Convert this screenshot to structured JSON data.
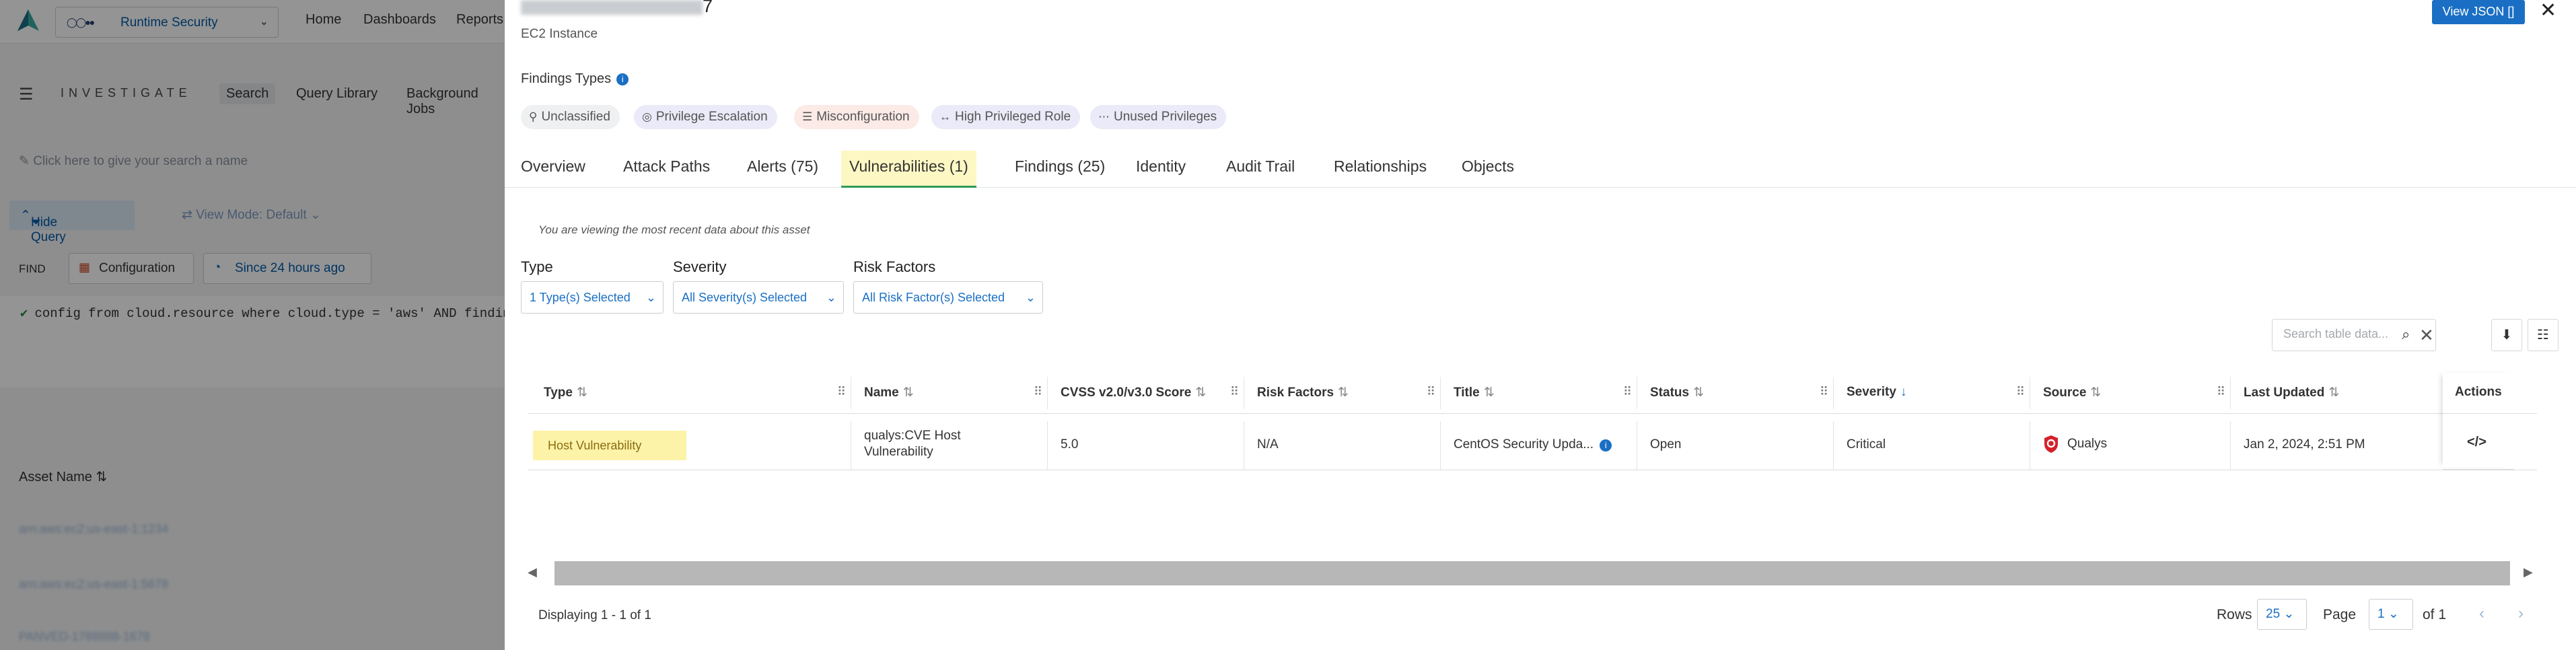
{
  "app": {
    "tenant_name": "Runtime Security",
    "nav": [
      "Home",
      "Dashboards",
      "Reports"
    ],
    "investigate_title": "INVESTIGATE",
    "investigate_tabs": [
      "Search",
      "Query Library",
      "Background Jobs"
    ],
    "search_name_placeholder": "Click here to give your search a name",
    "hide_query_label": "Hide Query",
    "view_mode_label": "View Mode: Default",
    "find_label": "FIND",
    "config_button": "Configuration",
    "time_button": "Since 24 hours ago",
    "query_text": "config from cloud.resource where cloud.type = 'aws' AND findin",
    "asset_name_header": "Asset Name",
    "asset_rows": [
      "arn:aws:ec2:us-east-1:1234",
      "arn:aws:ec2:us-east-1:5678",
      "PANVED-1788888-1678"
    ]
  },
  "panel": {
    "title_suffix": "7",
    "subtitle": "EC2 Instance",
    "view_json_label": "View JSON []",
    "close_icon": "close-icon",
    "findings_types_label": "Findings Types",
    "finding_chips": [
      {
        "label": "Unclassified",
        "icon": "search-icon",
        "glyph": "⚲",
        "bg": "#eef0f2",
        "fg": "#555555"
      },
      {
        "label": "Privilege Escalation",
        "icon": "privilege-escalation-icon",
        "glyph": "◎",
        "bg": "#eaeaf8",
        "fg": "#555555"
      },
      {
        "label": "Misconfiguration",
        "icon": "misconfiguration-icon",
        "glyph": "☰",
        "bg": "#fbeae6",
        "fg": "#555555"
      },
      {
        "label": "High Privileged Role",
        "icon": "high-privileged-role-icon",
        "glyph": "↔",
        "bg": "#eaeaf8",
        "fg": "#555555"
      },
      {
        "label": "Unused Privileges",
        "icon": "unused-privileges-icon",
        "glyph": "⋯",
        "bg": "#eaeaf8",
        "fg": "#555555"
      }
    ],
    "tabs": [
      "Overview",
      "Attack Paths",
      "Alerts (75)",
      "Vulnerabilities (1)",
      "Findings (25)",
      "Identity",
      "Audit Trail",
      "Relationships",
      "Objects"
    ],
    "active_tab": "Vulnerabilities (1)",
    "notice": "You are viewing the most recent data about this asset",
    "filters": {
      "type_label": "Type",
      "type_value": "1 Type(s) Selected",
      "severity_label": "Severity",
      "severity_value": "All Severity(s) Selected",
      "risk_label": "Risk Factors",
      "risk_value": "All Risk Factor(s) Selected"
    },
    "table_search_placeholder": "Search table data...",
    "columns": [
      "Type",
      "Name",
      "CVSS v2.0/v3.0 Score",
      "Risk Factors",
      "Title",
      "Status",
      "Severity",
      "Source",
      "Last Updated",
      "Actions"
    ],
    "row": {
      "type": "Host Vulnerability",
      "name_line1": "qualys:CVE Host",
      "name_line2": "Vulnerability",
      "cvss": "5.0",
      "risk_factors": "N/A",
      "title": "CentOS Security Upda...",
      "status": "Open",
      "severity": "Critical",
      "source": "Qualys",
      "last_updated": "Jan 2, 2024, 2:51 PM",
      "action_icon": "code-icon"
    },
    "footer": {
      "displaying": "Displaying 1 - 1 of 1",
      "rows_label": "Rows",
      "rows_value": "25",
      "page_label": "Page",
      "page_value": "1",
      "of_label": "of 1"
    }
  },
  "colors": {
    "accent": "#1a6fc4",
    "active_tab_bg": "#fdf7c3",
    "active_tab_underline": "#2e9a58",
    "type_badge_bg": "#fdf3a8",
    "qualys_red": "#d6202a"
  }
}
